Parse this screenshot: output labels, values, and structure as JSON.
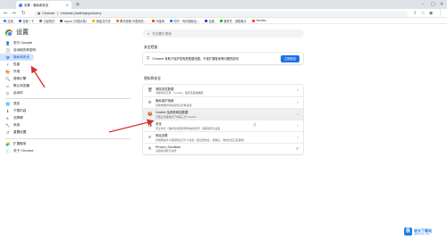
{
  "browser": {
    "tab_title": "设置 - 隐私和安全",
    "tab_close": "×",
    "new_tab": "+",
    "window_controls": {
      "minimize": "–",
      "maximize": "□",
      "close": "✕"
    },
    "omnibox": {
      "host": "Chrome",
      "url": "chrome://settings/privacy"
    },
    "bookmarks": [
      {
        "label": "应用",
        "color": "#4285f4"
      },
      {
        "label": "百度一下",
        "color": "#3b6fd8"
      },
      {
        "label": "已经知识",
        "color": "#777777"
      },
      {
        "label": "Apple (中国大陆)",
        "color": "#555555"
      },
      {
        "label": "新建文件夹",
        "color": "#f2b400"
      },
      {
        "label": "腾讯视频-中国领先...",
        "color": "#ff7a00"
      },
      {
        "label": "淘宝网",
        "color": "#ff4400"
      },
      {
        "label": "知乎 - 有问题就会...",
        "color": "#0084ff"
      },
      {
        "label": "百度",
        "color": "#2932e1"
      },
      {
        "label": "爱奇艺 - 追剧看片",
        "color": "#00be06"
      },
      {
        "label": "Yandex",
        "color": "#fc3f1d"
      }
    ]
  },
  "settings": {
    "title": "设置",
    "search_placeholder": "在设置中搜索",
    "sidebar": [
      {
        "icon": "👤",
        "icon_name": "person-icon",
        "label": "您与 Google"
      },
      {
        "icon": "📋",
        "icon_name": "autofill-icon",
        "label": "自动填充和密码"
      },
      {
        "icon": "🛡",
        "icon_name": "shield-icon",
        "label": "隐私和安全",
        "active": true
      },
      {
        "icon": "⚡",
        "icon_name": "performance-icon",
        "label": "性能"
      },
      {
        "icon": "🎨",
        "icon_name": "palette-icon",
        "label": "外观"
      },
      {
        "icon": "🔍",
        "icon_name": "search-icon",
        "label": "搜索引擎"
      },
      {
        "icon": "▭",
        "icon_name": "browser-icon",
        "label": "默认浏览器"
      },
      {
        "icon": "⏻",
        "icon_name": "power-icon",
        "label": "启动时"
      },
      {
        "divider": true
      },
      {
        "icon": "🌐",
        "icon_name": "globe-icon",
        "label": "语言"
      },
      {
        "icon": "⬇",
        "icon_name": "download-icon",
        "label": "下载内容"
      },
      {
        "icon": "♿",
        "icon_name": "accessibility-icon",
        "label": "无障碍"
      },
      {
        "icon": "🔧",
        "icon_name": "wrench-icon",
        "label": "系统"
      },
      {
        "icon": "↺",
        "icon_name": "reset-icon",
        "label": "重置设置"
      },
      {
        "divider": true
      },
      {
        "icon": "🧩",
        "icon_name": "extensions-icon",
        "label": "扩展程序"
      },
      {
        "icon": "ⓘ",
        "icon_name": "info-icon",
        "label": "关于 Chrome"
      }
    ],
    "safety_check": {
      "section_title": "安全检查",
      "text": "Chrome 有助于保护您免受数据泄露、不良扩展程序等问题的影响",
      "button": "立即检查"
    },
    "privacy": {
      "section_title": "隐私和安全",
      "rows": [
        {
          "icon": "🗑",
          "icon_name": "trash-icon",
          "title": "清除浏览数据",
          "desc": "清除浏览记录、Cookie、缓存及其他数据",
          "chevron": "›"
        },
        {
          "icon": "⚙",
          "icon_name": "privacy-guide-icon",
          "title": "隐私保护指南",
          "desc": "查看重要的隐私和安全控制设置",
          "chevron": "›"
        },
        {
          "icon": "🍪",
          "icon_name": "cookie-icon",
          "title": "Cookie 及其他网站数据",
          "desc": "已阻止无痕模式下的第三方 Cookie",
          "chevron": "›",
          "highlight": true
        },
        {
          "icon": "🛡",
          "icon_name": "shield-icon",
          "title": "安全",
          "desc": "安全浏览（保护您免受危险网站的侵害）和其他安全设置",
          "chevron": "›"
        },
        {
          "icon": "≡",
          "icon_name": "site-settings-icon",
          "title": "网站设置",
          "desc": "控制网站可以使用和显示什么信息（如位置信息、摄像头、弹出式窗口及其他）",
          "chevron": "›"
        },
        {
          "icon": "⚗",
          "icon_name": "flask-icon",
          "title": "Privacy Sandbox",
          "desc": "试用版功能已关闭",
          "chevron": "↗"
        }
      ]
    }
  },
  "watermark": {
    "logo_text": "极",
    "name": "极光下载站",
    "url": "www.xz7.com"
  },
  "colors": {
    "accent": "#1a73e8",
    "active_nav_bg": "#d3e3fd",
    "annotation_arrow": "#d93025"
  }
}
